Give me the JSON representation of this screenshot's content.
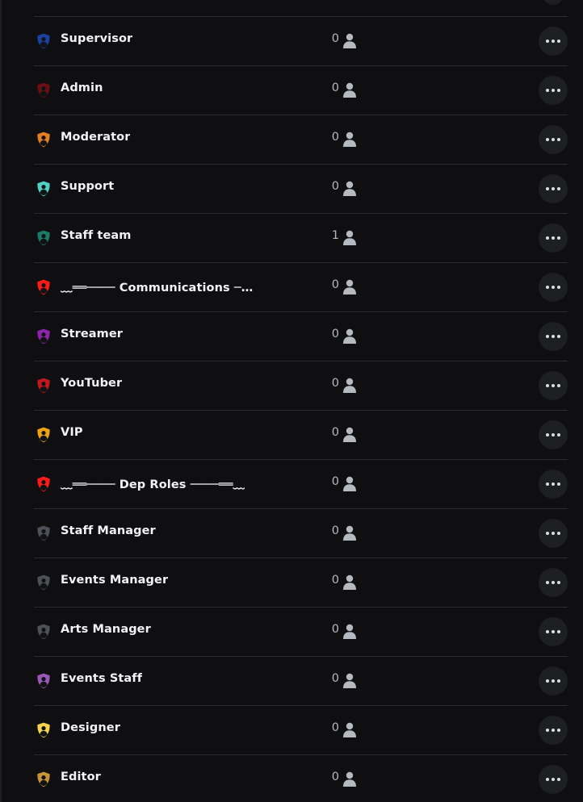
{
  "roles": [
    {
      "name": "Supervisor",
      "member_count": "0",
      "icon": "shield-user-icon",
      "color": "#1d3fa0"
    },
    {
      "name": "Admin",
      "member_count": "0",
      "icon": "shield-user-icon",
      "color": "#6b0f14"
    },
    {
      "name": "Moderator",
      "member_count": "0",
      "icon": "shield-user-icon",
      "color": "#e67e22"
    },
    {
      "name": "Support",
      "member_count": "0",
      "icon": "shield-user-icon",
      "color": "#4fd1c5"
    },
    {
      "name": "Staff team",
      "member_count": "1",
      "icon": "shield-user-icon",
      "color": "#1a7a6a"
    },
    {
      "name": "﹏══──── Communications ────══﹏",
      "member_count": "0",
      "icon": "shield-user-icon",
      "color": "#ff1a1a"
    },
    {
      "name": "Streamer",
      "member_count": "0",
      "icon": "shield-user-icon",
      "color": "#8e24aa"
    },
    {
      "name": "YouTuber",
      "member_count": "0",
      "icon": "shield-user-icon",
      "color": "#c2181c"
    },
    {
      "name": "VIP",
      "member_count": "0",
      "icon": "shield-user-icon",
      "color": "#f1a20f"
    },
    {
      "name": "﹏══──── Dep Roles ────══﹏",
      "member_count": "0",
      "icon": "shield-user-icon",
      "color": "#ff1a1a"
    },
    {
      "name": "Staff Manager",
      "member_count": "0",
      "icon": "shield-user-icon",
      "color": "#4e5058"
    },
    {
      "name": "Events Manager",
      "member_count": "0",
      "icon": "shield-user-icon",
      "color": "#4e5058"
    },
    {
      "name": "Arts Manager",
      "member_count": "0",
      "icon": "shield-user-icon",
      "color": "#4e5058"
    },
    {
      "name": "Events Staff",
      "member_count": "0",
      "icon": "shield-user-icon",
      "color": "#9b59b6"
    },
    {
      "name": "Designer",
      "member_count": "0",
      "icon": "shield-user-icon",
      "color": "#f8d34a"
    },
    {
      "name": "Editor",
      "member_count": "0",
      "icon": "shield-user-icon",
      "color": "#c99436"
    }
  ],
  "member_icon": "person-icon",
  "more_icon": "ellipsis-icon",
  "colors": {
    "background": "#0f0f11",
    "divider": "#2a2b30",
    "more_button_bg": "#1e1f22",
    "text_primary": "#f2f3f5",
    "text_secondary": "#b5bac1"
  }
}
